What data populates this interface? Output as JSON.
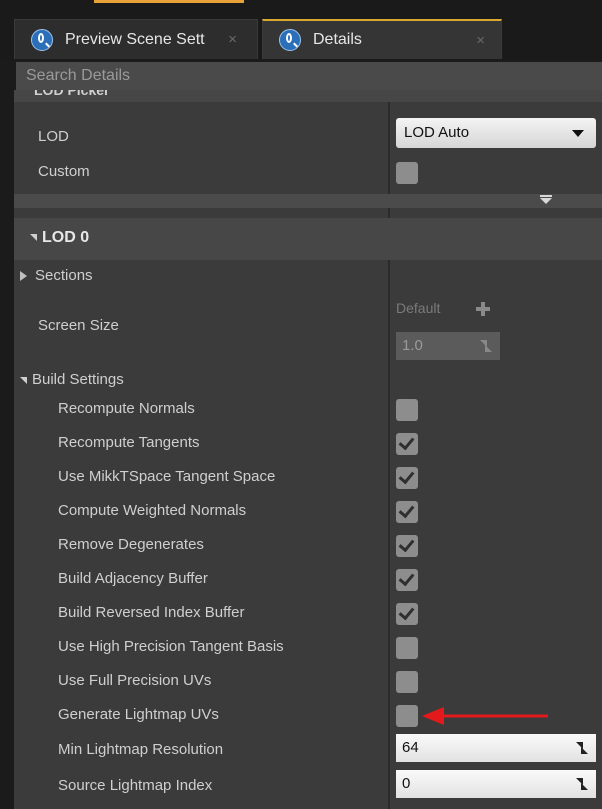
{
  "tabs": [
    {
      "label": "Preview Scene Sett",
      "close": "×"
    },
    {
      "label": "Details",
      "close": "×"
    }
  ],
  "search": {
    "placeholder": "Search Details"
  },
  "lod_picker": {
    "header": "LOD Picker",
    "lod_label": "LOD",
    "lod_value": "LOD Auto",
    "custom_label": "Custom",
    "custom_checked": false
  },
  "lod0": {
    "header": "LOD 0",
    "sections_label": "Sections",
    "screen_size_label": "Screen Size",
    "screen_size_default": "Default",
    "screen_size_value": "1.0",
    "build_settings_label": "Build Settings",
    "settings": [
      {
        "label": "Recompute Normals",
        "checked": false
      },
      {
        "label": "Recompute Tangents",
        "checked": true
      },
      {
        "label": "Use MikkTSpace Tangent Space",
        "checked": true
      },
      {
        "label": "Compute Weighted Normals",
        "checked": true
      },
      {
        "label": "Remove Degenerates",
        "checked": true
      },
      {
        "label": "Build Adjacency Buffer",
        "checked": true
      },
      {
        "label": "Build Reversed Index Buffer",
        "checked": true
      },
      {
        "label": "Use High Precision Tangent Basis",
        "checked": false
      },
      {
        "label": "Use Full Precision UVs",
        "checked": false
      },
      {
        "label": "Generate Lightmap UVs",
        "checked": false
      }
    ],
    "min_lightmap_label": "Min Lightmap Resolution",
    "min_lightmap_value": "64",
    "source_lightmap_label": "Source Lightmap Index",
    "source_lightmap_value": "0"
  },
  "colors": {
    "annotation_arrow": "#e3191c",
    "tab_accent": "#e8a23a"
  }
}
